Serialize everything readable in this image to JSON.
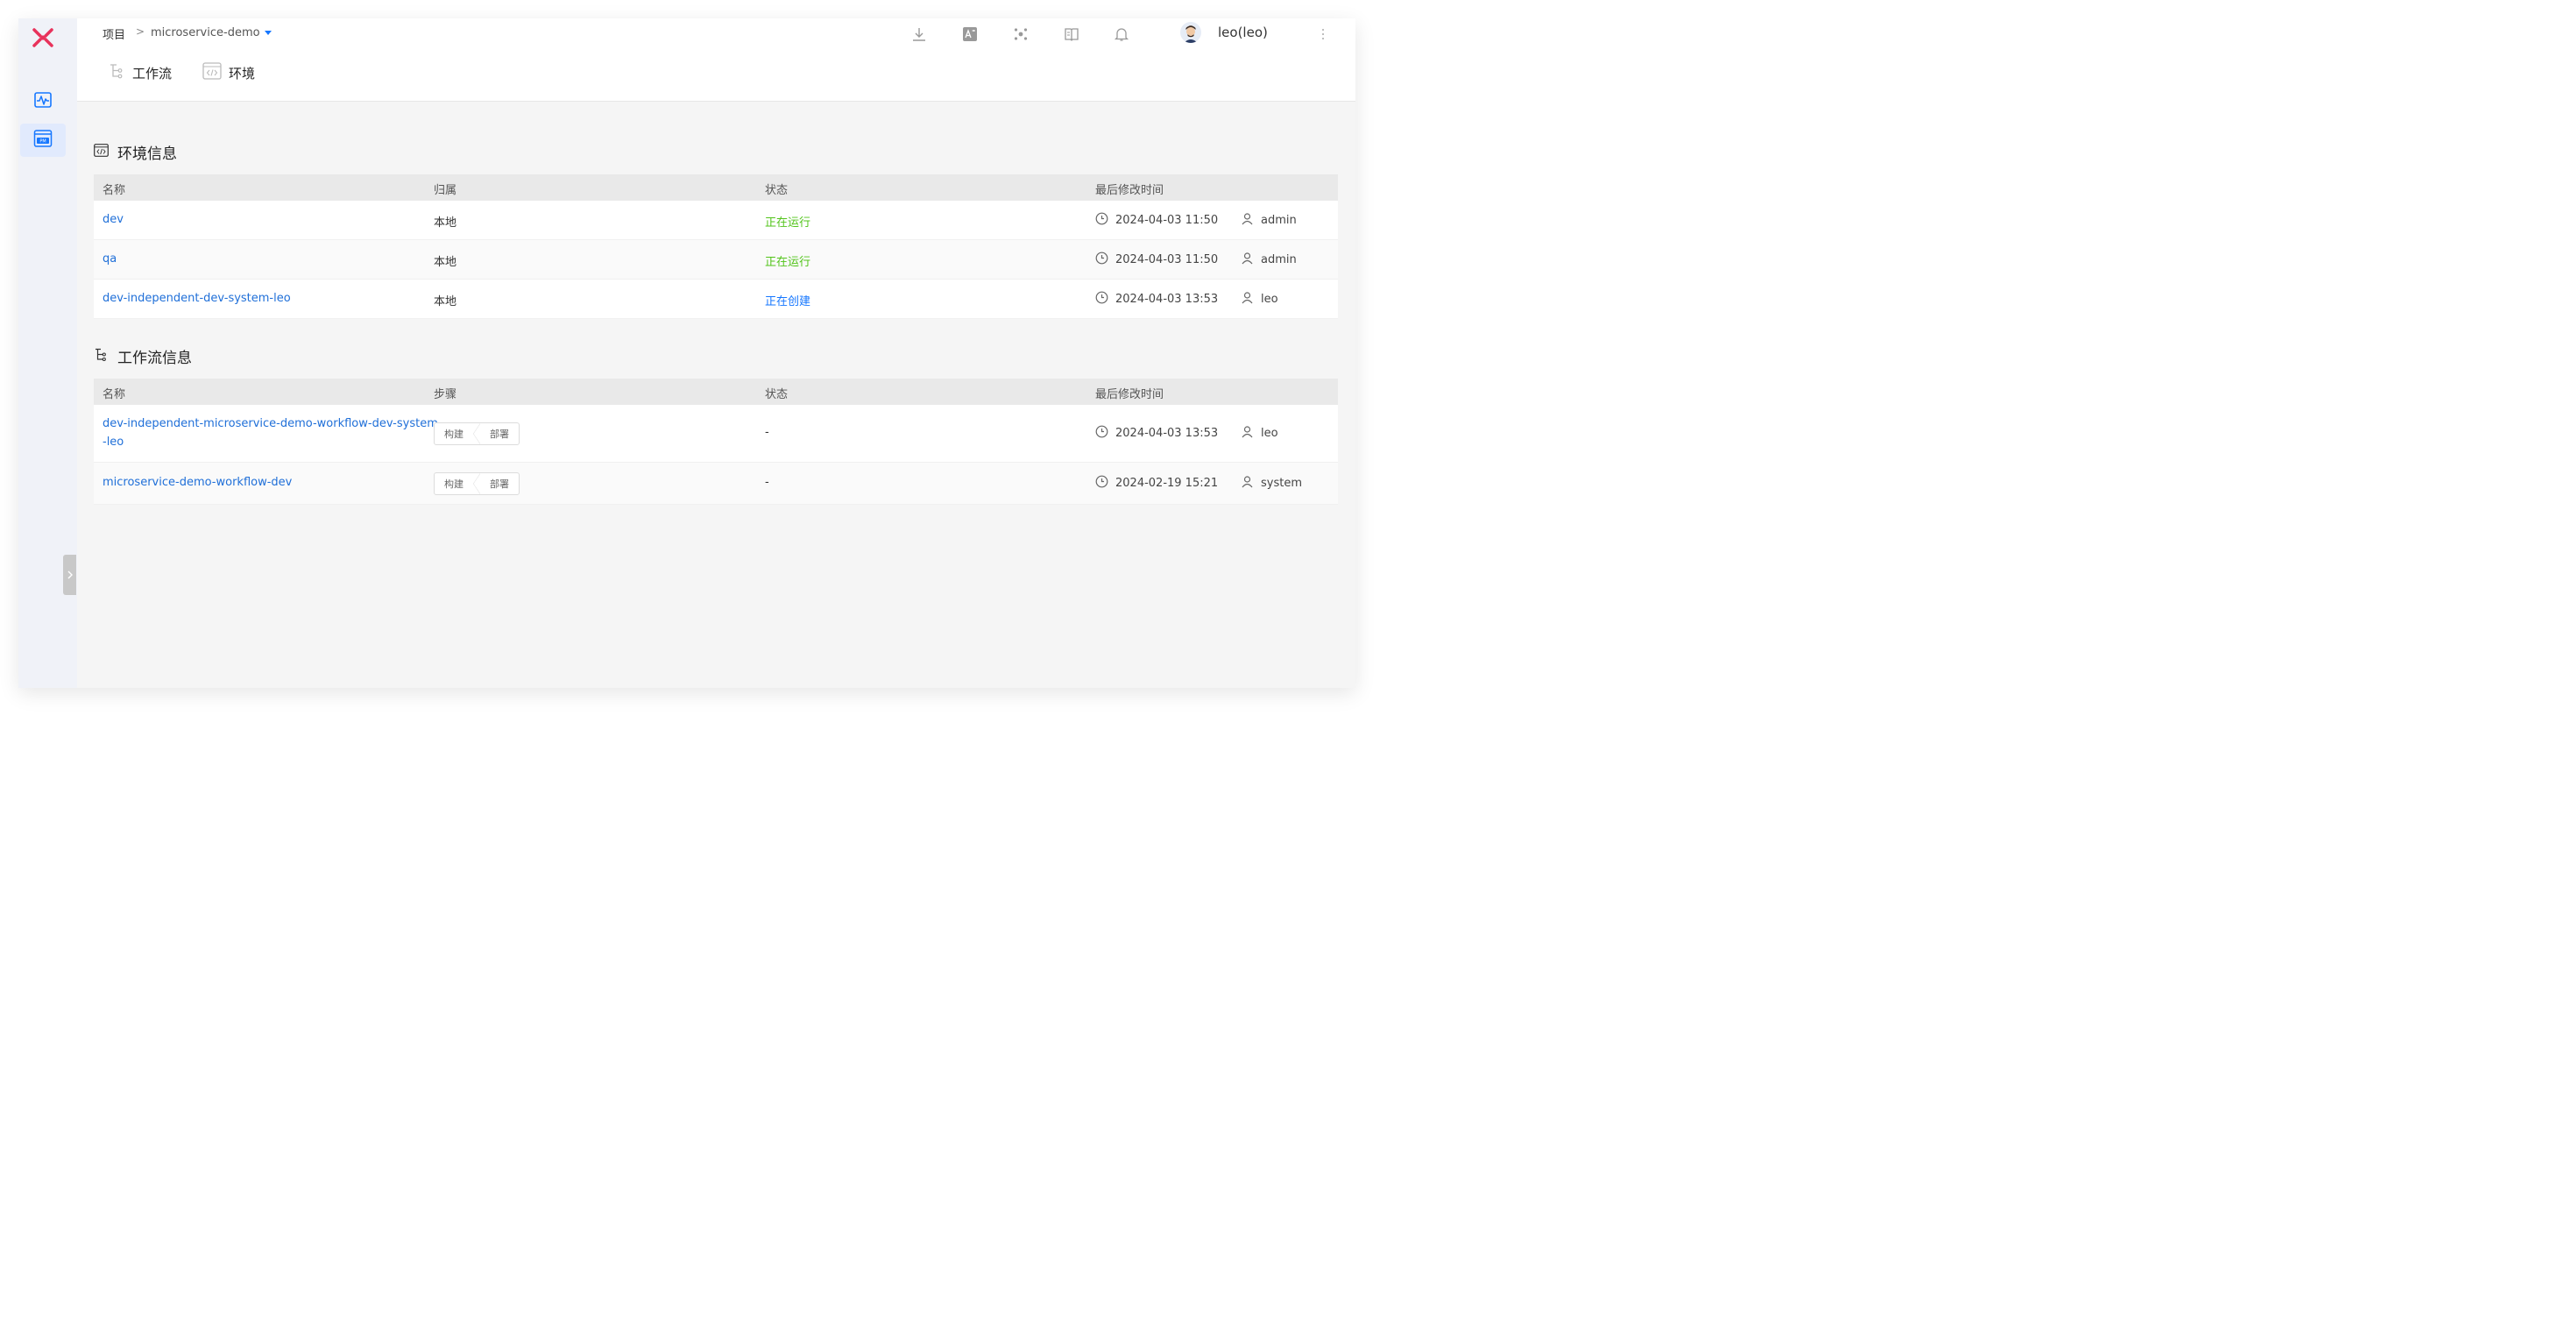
{
  "breadcrumb": {
    "root": "项目",
    "separator": ">",
    "project": "microservice-demo"
  },
  "user": {
    "name": "leo(leo)"
  },
  "subnav": [
    {
      "label": "工作流",
      "icon": "workflow-icon"
    },
    {
      "label": "环境",
      "icon": "code-icon"
    }
  ],
  "env_section": {
    "title": "环境信息",
    "headers": [
      "名称",
      "归属",
      "状态",
      "最后修改时间"
    ],
    "rows": [
      {
        "name": "dev",
        "owner": "本地",
        "status": "正在运行",
        "time": "2024-04-03 11:50",
        "user": "admin"
      },
      {
        "name": "qa",
        "owner": "本地",
        "status": "正在运行",
        "time": "2024-04-03 11:50",
        "user": "admin"
      },
      {
        "name": "dev-independent-dev-system-leo",
        "owner": "本地",
        "status": "正在创建",
        "time": "2024-04-03 13:53",
        "user": "leo"
      }
    ]
  },
  "wf_section": {
    "title": "工作流信息",
    "headers": [
      "名称",
      "步骤",
      "状态",
      "最后修改时间"
    ],
    "rows": [
      {
        "name_line1": "dev-independent-microservice-demo-workflow-dev-system",
        "name_line2": "-leo",
        "step1": "构建",
        "step2": "部署",
        "status": "-",
        "time": "2024-04-03 13:53",
        "user": "leo"
      },
      {
        "name_line1": "microservice-demo-workflow-dev",
        "name_line2": "",
        "step1": "构建",
        "step2": "部署",
        "status": "-",
        "time": "2024-02-19 15:21",
        "user": "system"
      }
    ]
  },
  "colors": {
    "accent": "#1677ff",
    "link": "#1f6fd8",
    "running": "#52c41a",
    "logo": "#e8325b"
  }
}
